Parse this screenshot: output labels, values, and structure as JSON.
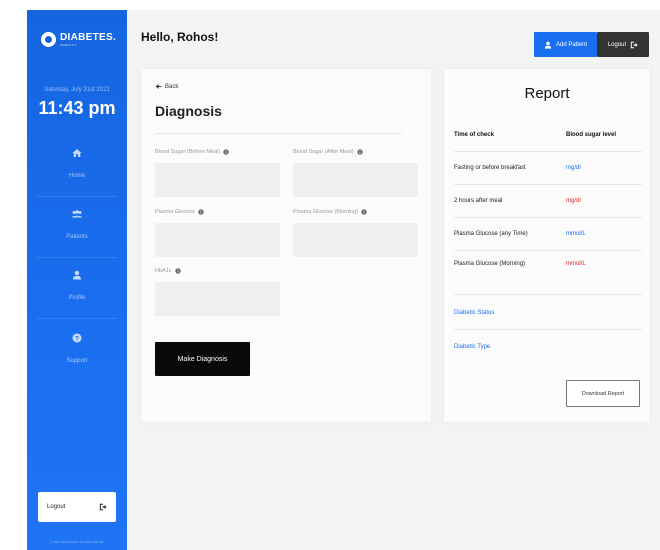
{
  "sidebar": {
    "brand": {
      "name": "DIABETES.",
      "sub": "PREDICT"
    },
    "date": "Saturday, July 31st 2021",
    "time": "11:43 pm",
    "nav": [
      {
        "label": "Home",
        "icon": "home-icon"
      },
      {
        "label": "Patients",
        "icon": "users-icon"
      },
      {
        "label": "Profile",
        "icon": "user-icon"
      },
      {
        "label": "Support",
        "icon": "question-icon"
      }
    ],
    "logout_label": "Logout",
    "copyright": "© 2021 Diab Predict. All rights reserved"
  },
  "header": {
    "greeting": "Hello, Rohos!",
    "add_patient_label": "Add Patient",
    "logout_label": "Logout"
  },
  "diagnosis": {
    "back_label": "Back",
    "title": "Diagnosis",
    "fields": [
      {
        "label": "Blood Sugar (Before Meal)",
        "value": ""
      },
      {
        "label": "Blood Sugar (After Meal)",
        "value": ""
      },
      {
        "label": "Plasma Glucose",
        "value": ""
      },
      {
        "label": "Plasma Glucose (Morning)",
        "value": ""
      },
      {
        "label": "HbA1c",
        "value": ""
      }
    ],
    "submit_label": "Make Diagnosis"
  },
  "report": {
    "title": "Report",
    "columns": [
      "Time of check",
      "Blood sugar level"
    ],
    "rows": [
      {
        "check": "Fasting or before breakfast",
        "level": "mg/dl",
        "color": "#1a6ef0"
      },
      {
        "check": "2 hours after meal",
        "level": "mg/dl",
        "color": "#e0262a"
      },
      {
        "check": "Plasma Glucose (any Time)",
        "level": "mmol/L",
        "color": "#1a6ef0"
      },
      {
        "check": "Plasma Glucose (Morning)",
        "level": "mmol/L",
        "color": "#e0262a"
      }
    ],
    "status_label": "Diabetic Status",
    "type_label": "Diabetic Type",
    "download_label": "Download Report"
  },
  "colors": {
    "primary": "#1a6ef0",
    "danger": "#e0262a",
    "dark": "#333333"
  }
}
